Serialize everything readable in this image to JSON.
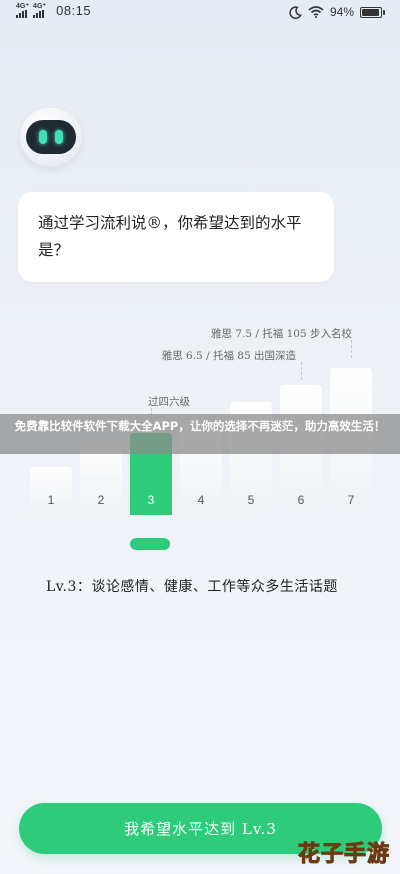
{
  "status_bar": {
    "sim1": "4G⁺",
    "sim2": "4G⁺",
    "time": "08:15",
    "battery_pct": "94%",
    "battery_level": 0.94
  },
  "question": {
    "text": "通过学习流利说®，你希望达到的水平是？"
  },
  "chart": {
    "bars": [
      {
        "label": "1",
        "level": 1,
        "active": false
      },
      {
        "label": "2",
        "level": 2,
        "active": false
      },
      {
        "label": "3",
        "level": 3,
        "active": true
      },
      {
        "label": "4",
        "level": 4,
        "active": false
      },
      {
        "label": "5",
        "level": 5,
        "active": false
      },
      {
        "label": "6",
        "level": 6,
        "active": false
      },
      {
        "label": "7",
        "level": 7,
        "active": false
      }
    ],
    "markers": [
      {
        "text": "雅思 7.5 / 托福 105 步入名校"
      },
      {
        "text": "雅思 6.5 / 托福 85 出国深造"
      },
      {
        "text": "过四六级"
      }
    ]
  },
  "selected_level_desc": "Lv.3：谈论感情、健康、工作等众多生活话题",
  "overlay_banner": "免费靠比较件软件下载大全APP，让你的选择不再迷茫，助力高效生活！",
  "cta_label": "我希望水平达到 Lv.3",
  "watermark": "花子手游",
  "colors": {
    "accent": "#2ecc7a",
    "background": "#eef2f7"
  }
}
